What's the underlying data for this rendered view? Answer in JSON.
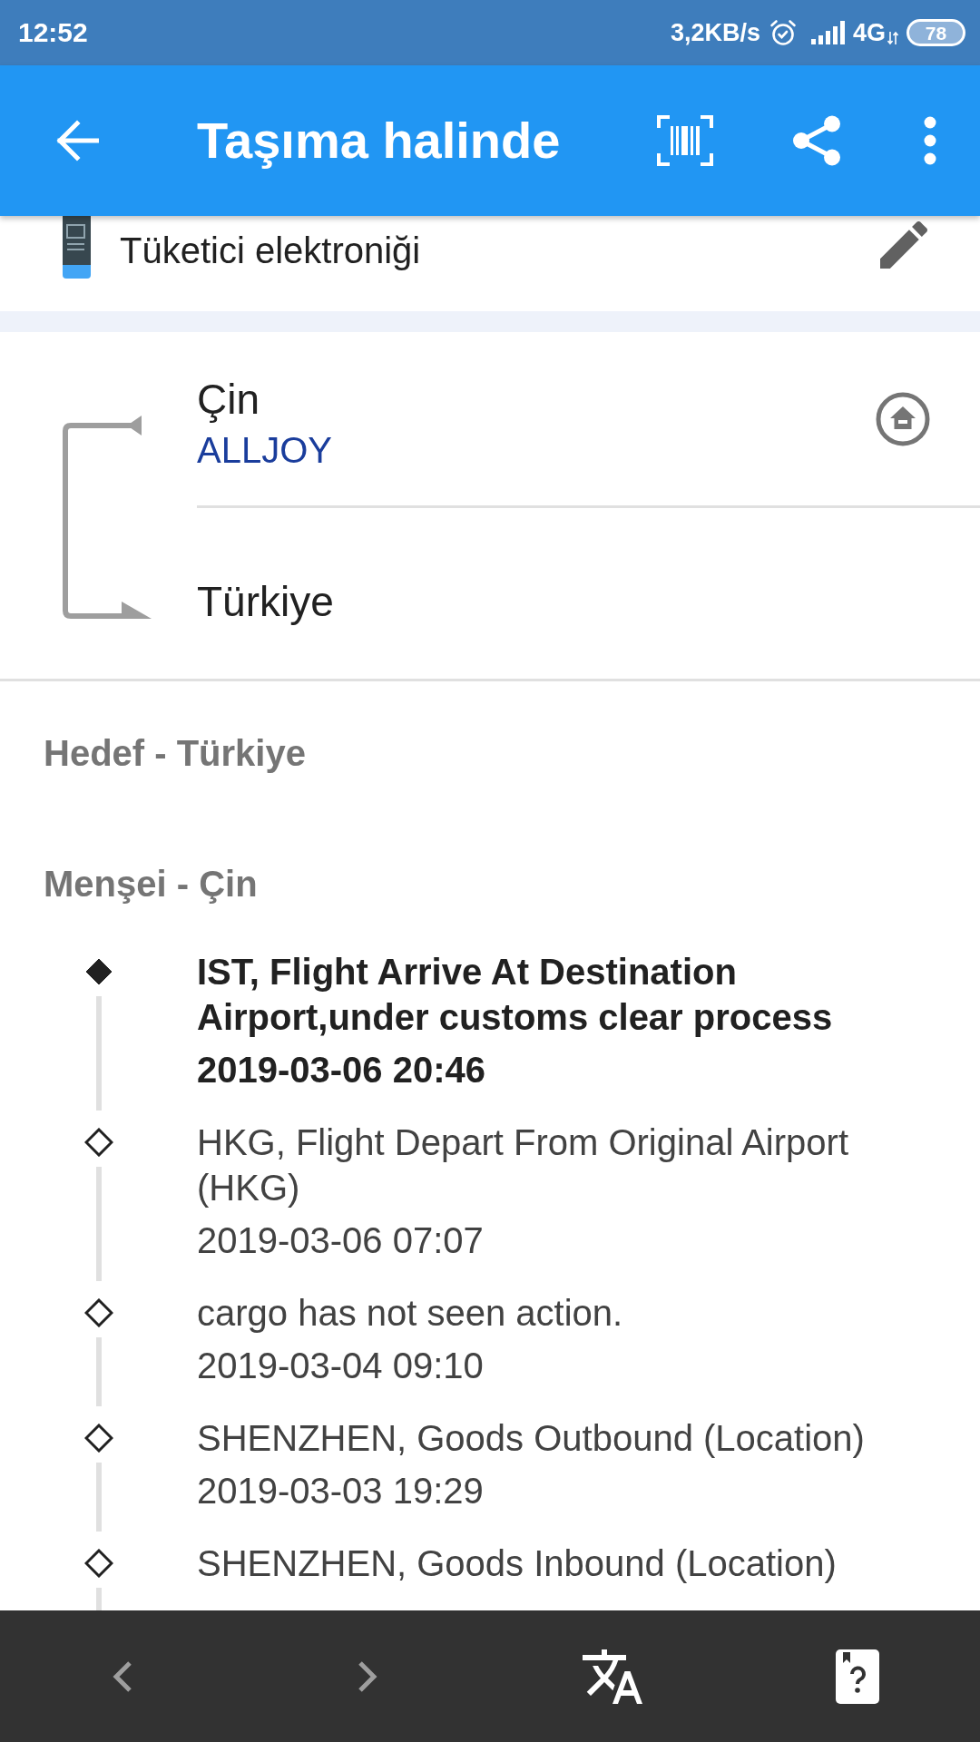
{
  "status_bar": {
    "time": "12:52",
    "network_speed": "3,2KB/s",
    "network_type": "4G",
    "battery": "78"
  },
  "app_bar": {
    "title": "Taşıma halinde"
  },
  "category": {
    "label": "Tüketici elektroniği"
  },
  "route": {
    "origin": "Çin",
    "carrier": "ALLJOY",
    "destination": "Türkiye"
  },
  "destination_heading": "Hedef - Türkiye",
  "origin_heading": "Menşei - Çin",
  "events": [
    {
      "description": "IST, Flight Arrive At Destination Airport,under customs clear process",
      "time": "2019-03-06 20:46",
      "latest": true
    },
    {
      "description": "HKG, Flight Depart From Original Airport (HKG)",
      "time": "2019-03-06 07:07",
      "latest": false
    },
    {
      "description": "cargo has not seen action.",
      "time": "2019-03-04 09:10",
      "latest": false
    },
    {
      "description": "SHENZHEN, Goods Outbound (Location)",
      "time": "2019-03-03 19:29",
      "latest": false
    },
    {
      "description": "SHENZHEN, Goods Inbound (Location)",
      "latest": false
    }
  ]
}
